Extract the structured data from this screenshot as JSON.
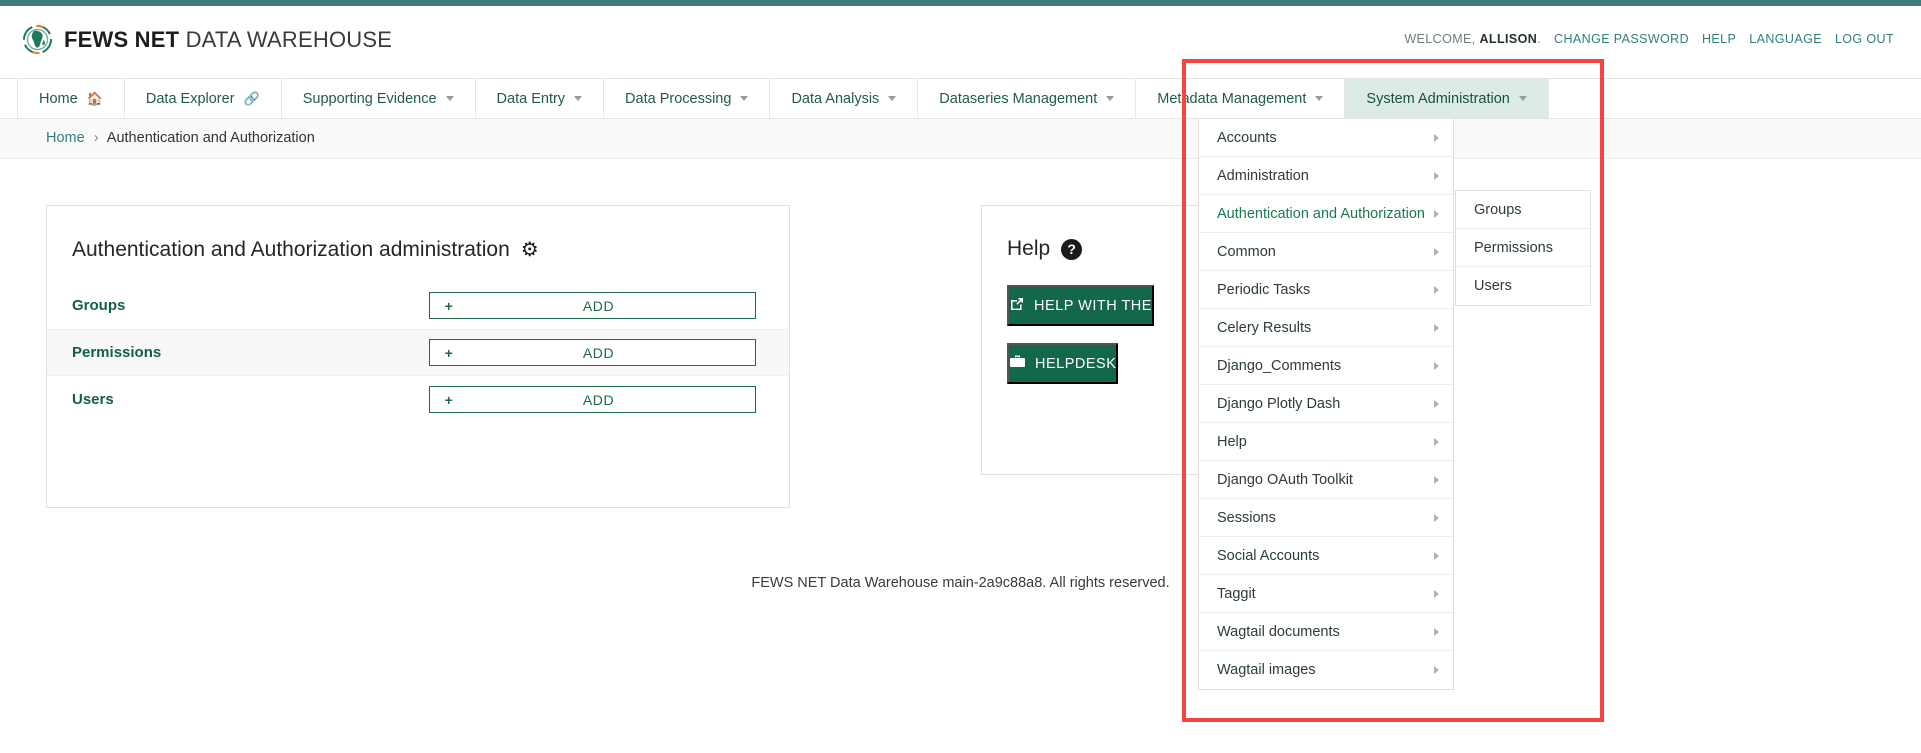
{
  "brand": {
    "primary": "FEWS NET",
    "secondary": "DATA WAREHOUSE",
    "logo_icon": "globe-icon"
  },
  "header": {
    "welcome_prefix": "WELCOME, ",
    "welcome_user": "ALLISON",
    "welcome_suffix": ".",
    "links": [
      {
        "label": "CHANGE PASSWORD"
      },
      {
        "label": "HELP"
      },
      {
        "label": "LANGUAGE"
      },
      {
        "label": "LOG OUT"
      }
    ]
  },
  "nav": {
    "items": [
      {
        "label": "Home",
        "icon": "home-icon",
        "active": false
      },
      {
        "label": "Data Explorer",
        "icon": "link-icon",
        "active": false
      },
      {
        "label": "Supporting Evidence",
        "icon": "chevron-down-icon",
        "active": false
      },
      {
        "label": "Data Entry",
        "icon": "chevron-down-icon",
        "active": false
      },
      {
        "label": "Data Processing",
        "icon": "chevron-down-icon",
        "active": false
      },
      {
        "label": "Data Analysis",
        "icon": "chevron-down-icon",
        "active": false
      },
      {
        "label": "Dataseries Management",
        "icon": "chevron-down-icon",
        "active": false
      },
      {
        "label": "Metadata Management",
        "icon": "chevron-down-icon",
        "active": false
      },
      {
        "label": "System Administration",
        "icon": "chevron-down-icon",
        "active": true
      }
    ]
  },
  "breadcrumb": {
    "home": "Home",
    "separator": "›",
    "current": "Authentication and Authorization"
  },
  "admin_card": {
    "title": "Authentication and Authorization administration",
    "title_icon": "gear-icon",
    "rows": [
      {
        "label": "Groups",
        "add_label": "ADD",
        "plus": "+"
      },
      {
        "label": "Permissions",
        "add_label": "ADD",
        "plus": "+"
      },
      {
        "label": "Users",
        "add_label": "ADD",
        "plus": "+"
      }
    ]
  },
  "help_card": {
    "title": "Help",
    "title_icon": "question-circle-icon",
    "buttons": [
      {
        "label": "HELP WITH THE",
        "icon": "external-link-icon"
      },
      {
        "label": "HELPDESK",
        "icon": "briefcase-icon"
      }
    ]
  },
  "dropdown": {
    "items": [
      {
        "label": "Accounts",
        "selected": false
      },
      {
        "label": "Administration",
        "selected": false
      },
      {
        "label": "Authentication and Authorization",
        "selected": true
      },
      {
        "label": "Common",
        "selected": false
      },
      {
        "label": "Periodic Tasks",
        "selected": false
      },
      {
        "label": "Celery Results",
        "selected": false
      },
      {
        "label": "Django_Comments",
        "selected": false
      },
      {
        "label": "Django Plotly Dash",
        "selected": false
      },
      {
        "label": "Help",
        "selected": false
      },
      {
        "label": "Django OAuth Toolkit",
        "selected": false
      },
      {
        "label": "Sessions",
        "selected": false
      },
      {
        "label": "Social Accounts",
        "selected": false
      },
      {
        "label": "Taggit",
        "selected": false
      },
      {
        "label": "Wagtail documents",
        "selected": false
      },
      {
        "label": "Wagtail images",
        "selected": false
      }
    ]
  },
  "submenu": {
    "items": [
      {
        "label": "Groups"
      },
      {
        "label": "Permissions"
      },
      {
        "label": "Users"
      }
    ]
  },
  "footer": {
    "text": "FEWS NET Data Warehouse main-2a9c88a8. All rights reserved."
  },
  "colors": {
    "accent_green": "#13674a",
    "teal": "#2f7f7c",
    "annotation_red": "#f4453f",
    "active_nav_bg": "#dcebe7"
  }
}
